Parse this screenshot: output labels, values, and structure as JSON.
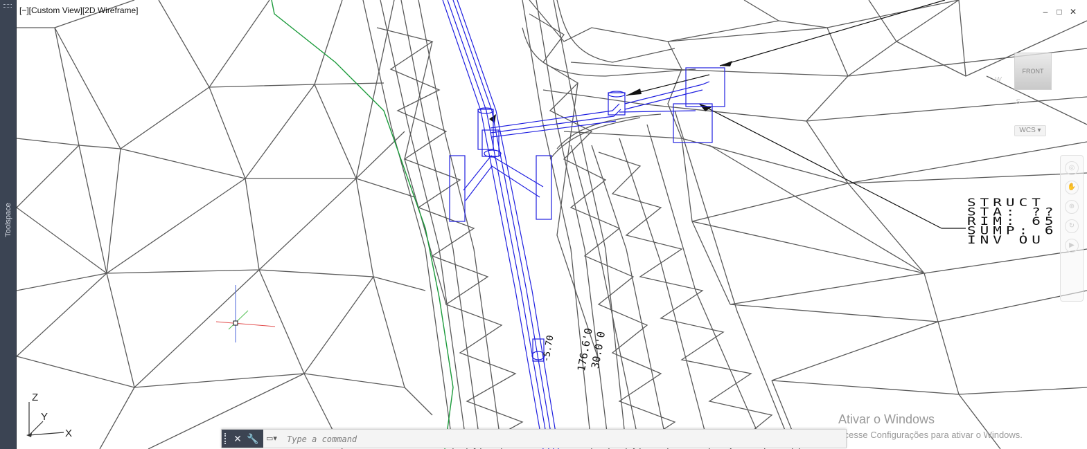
{
  "toolspace": {
    "label": "Toolspace"
  },
  "viewport": {
    "label": "[−][Custom View][2D Wireframe]",
    "window_controls": {
      "minimize": "–",
      "restore": "□",
      "close": "✕"
    },
    "viewcube": {
      "face": "FRONT"
    },
    "wcs": {
      "label": "WCS ▾"
    },
    "ucs": {
      "z": "Z",
      "y": "Y",
      "x": "X"
    }
  },
  "annotations": {
    "structure_lines": [
      "STRUCT",
      "STA: ??",
      "RIM: 65",
      "SUMP: 6",
      "INV OU"
    ],
    "pipe_labels": [
      "-5.70",
      "176.6'0",
      "30.0'0"
    ]
  },
  "command_line": {
    "placeholder": "Type a command",
    "close_icon": "close-icon",
    "customize_icon": "wrench-icon",
    "prompt_icon": "command-prompt-icon"
  },
  "watermark": {
    "title": "Ativar o Windows",
    "subtitle": "Acesse Configurações para ativar o Windows."
  },
  "colors": {
    "toolspace_bg": "#3b4453",
    "mesh": "#5a5a5a",
    "pipes": "#1f1fe0",
    "boundary": "#1a9a3a"
  }
}
